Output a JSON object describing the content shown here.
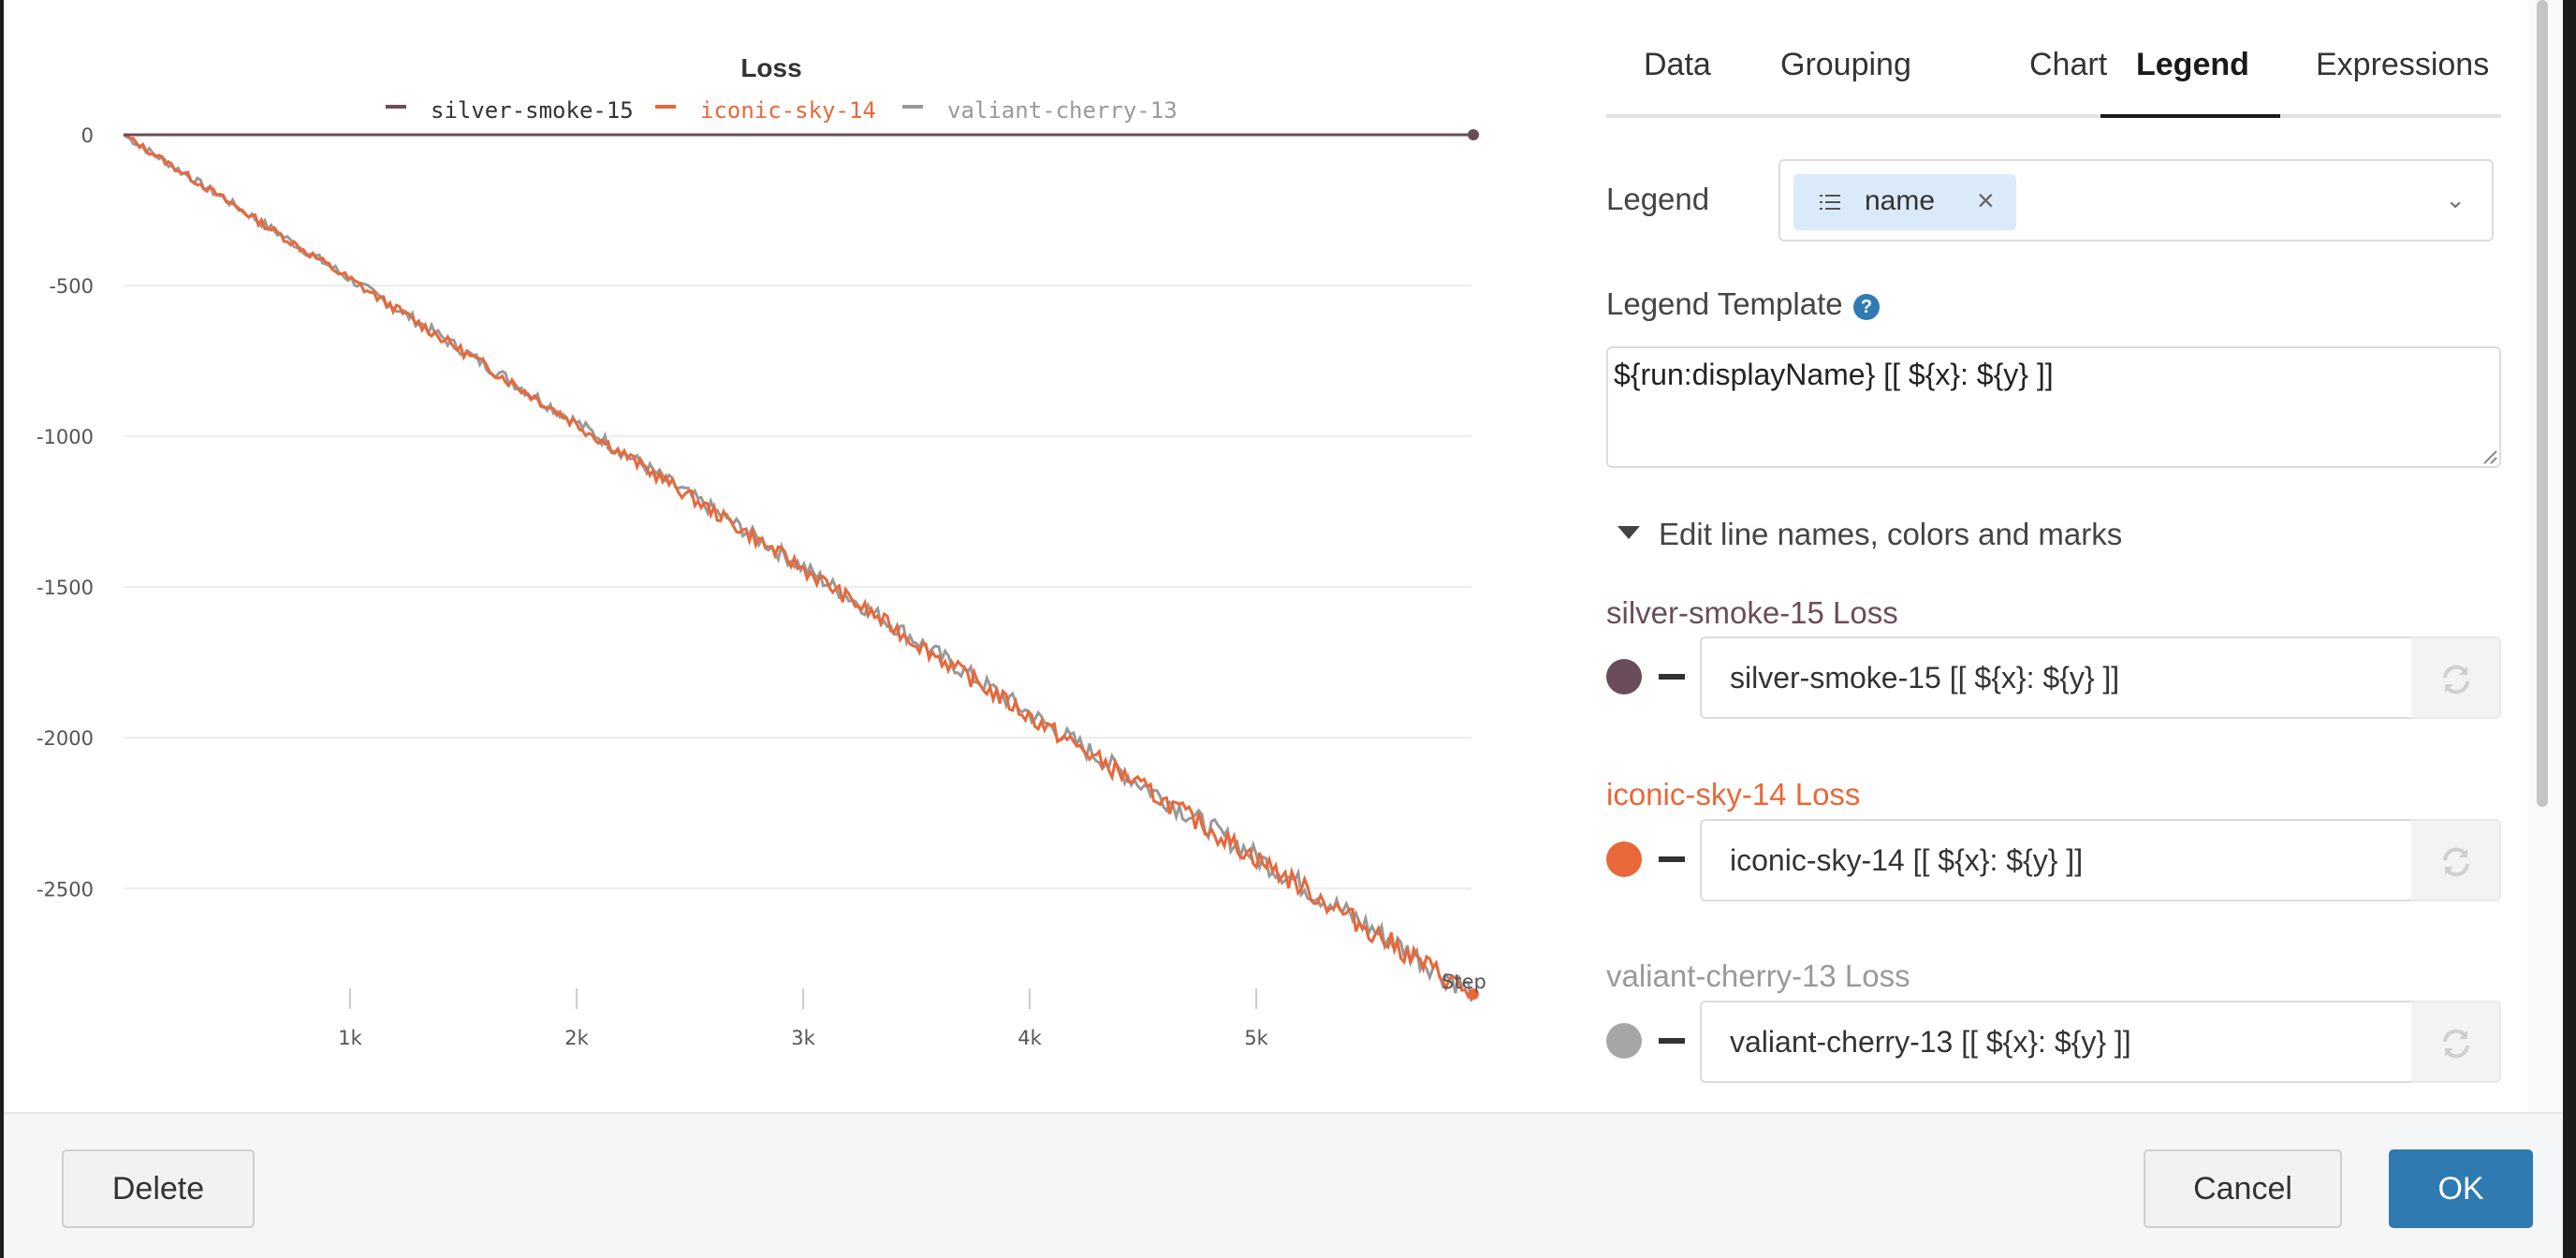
{
  "chart": {
    "legend": [
      {
        "name": "silver-smoke-15",
        "color": "#6b4c5b"
      },
      {
        "name": "iconic-sky-14",
        "color": "#e8683a"
      },
      {
        "name": "valiant-cherry-13",
        "color": "#999999"
      }
    ]
  },
  "chart_data": {
    "type": "line",
    "title": "Loss",
    "xlabel": "Step",
    "ylabel": "",
    "x_ticks": [
      "1k",
      "2k",
      "3k",
      "4k",
      "5k"
    ],
    "y_ticks": [
      "0",
      "-500",
      "-1000",
      "-1500",
      "-2000",
      "-2500"
    ],
    "xlim": [
      0,
      5950
    ],
    "ylim": [
      -2850,
      0
    ],
    "grid": true,
    "legend_position": "top",
    "series": [
      {
        "name": "silver-smoke-15",
        "color": "#6b4c5b",
        "x": [
          0,
          5950
        ],
        "y": [
          0,
          0
        ]
      },
      {
        "name": "iconic-sky-14",
        "color": "#e8683a",
        "x": [
          0,
          1000,
          2000,
          3000,
          4000,
          5000,
          5950
        ],
        "y": [
          0,
          -480,
          -960,
          -1440,
          -1930,
          -2400,
          -2850
        ]
      },
      {
        "name": "valiant-cherry-13",
        "color": "#999999",
        "x": [
          0,
          1000,
          2000,
          3000,
          4000,
          5000,
          5950
        ],
        "y": [
          0,
          -478,
          -955,
          -1435,
          -1920,
          -2395,
          -2840
        ]
      }
    ]
  },
  "tabs": [
    {
      "label": "Data"
    },
    {
      "label": "Grouping"
    },
    {
      "label": "Chart"
    },
    {
      "label": "Legend"
    },
    {
      "label": "Expressions"
    }
  ],
  "active_tab": "Legend",
  "legend_field": {
    "label": "Legend",
    "chip": "name"
  },
  "legend_template": {
    "label": "Legend Template",
    "value": "${run:displayName} [[ ${x}: ${y} ]]"
  },
  "edit_section": {
    "label": "Edit line names, colors and marks"
  },
  "series_editors": [
    {
      "title": "silver-smoke-15 Loss",
      "value": "silver-smoke-15 [[ ${x}: ${y} ]]",
      "color": "#6b4c5b",
      "title_color": "#6b4c5b"
    },
    {
      "title": "iconic-sky-14 Loss",
      "value": "iconic-sky-14 [[ ${x}: ${y} ]]",
      "color": "#e8683a",
      "title_color": "#e8683a"
    },
    {
      "title": "valiant-cherry-13 Loss",
      "value": "valiant-cherry-13 [[ ${x}: ${y} ]]",
      "color": "#a6a6a6",
      "title_color": "#999999"
    }
  ],
  "footer": {
    "delete_label": "Delete",
    "cancel_label": "Cancel",
    "ok_label": "OK"
  }
}
